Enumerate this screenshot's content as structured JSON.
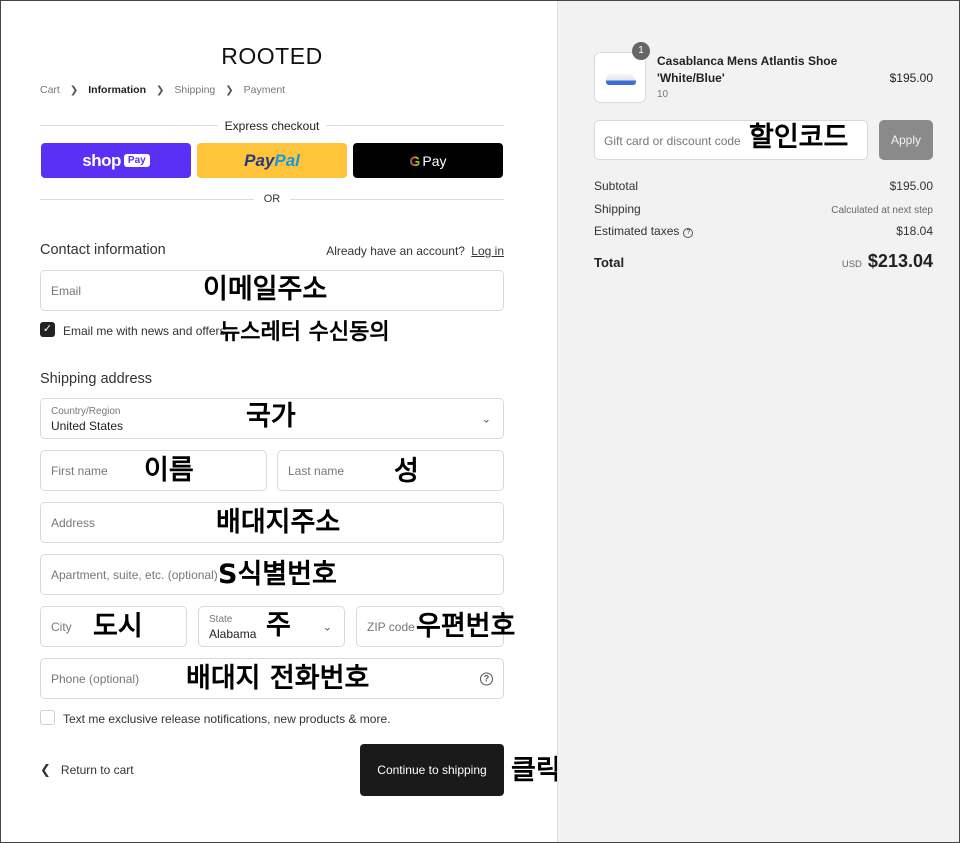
{
  "store": {
    "name": "ROOTED"
  },
  "breadcrumb": {
    "cart": "Cart",
    "information": "Information",
    "shipping": "Shipping",
    "payment": "Payment"
  },
  "express": {
    "title": "Express checkout",
    "shop_pay": "shop",
    "shop_pay_badge": "Pay",
    "paypal_a": "Pay",
    "paypal_b": "Pal",
    "gpay_g": "G",
    "gpay": "Pay",
    "or": "OR"
  },
  "contact": {
    "title": "Contact information",
    "account_prompt": "Already have an account?",
    "login_link": "Log in",
    "email_placeholder": "Email",
    "newsletter_label": "Email me with news and offers",
    "newsletter_checked": true
  },
  "shipping": {
    "title": "Shipping address",
    "country_label": "Country/Region",
    "country_value": "United States",
    "first_name": "First name",
    "last_name": "Last name",
    "address": "Address",
    "apartment": "Apartment, suite, etc. (optional)",
    "city": "City",
    "state_label": "State",
    "state_value": "Alabama",
    "zip": "ZIP code",
    "phone": "Phone (optional)",
    "sms_label": "Text me exclusive release notifications, new products & more.",
    "sms_checked": false
  },
  "actions": {
    "return": "Return to cart",
    "continue": "Continue to shipping"
  },
  "annotations": {
    "email": "이메일주소",
    "newsletter": "뉴스레터 수신동의",
    "country": "국가",
    "first_name": "이름",
    "last_name": "성",
    "address": "배대지주소",
    "apartment": "S식별번호",
    "city": "도시",
    "state": "주",
    "zip": "우편번호",
    "phone": "배대지 전화번호",
    "click": "클릭",
    "discount": "할인코드"
  },
  "order": {
    "quantity": "1",
    "product_name": "Casablanca Mens Atlantis Shoe 'White/Blue'",
    "variant": "10",
    "price": "$195.00",
    "discount_placeholder": "Gift card or discount code",
    "apply": "Apply",
    "subtotal_label": "Subtotal",
    "subtotal": "$195.00",
    "shipping_label": "Shipping",
    "shipping_value": "Calculated at next step",
    "taxes_label": "Estimated taxes",
    "taxes": "$18.04",
    "total_label": "Total",
    "currency": "USD",
    "total": "$213.04"
  },
  "icons": {
    "chevron": "chevron-down-icon",
    "check": "check-icon",
    "help": "help-circle-icon",
    "back": "chevron-left-icon",
    "info": "info-icon"
  },
  "colors": {
    "shop_pay": "#5a31f4",
    "paypal": "#ffc439",
    "gpay": "#000000",
    "primary_button": "#1a1a1a",
    "apply_button": "#8a8a8a",
    "summary_bg": "#f2f2f2"
  }
}
